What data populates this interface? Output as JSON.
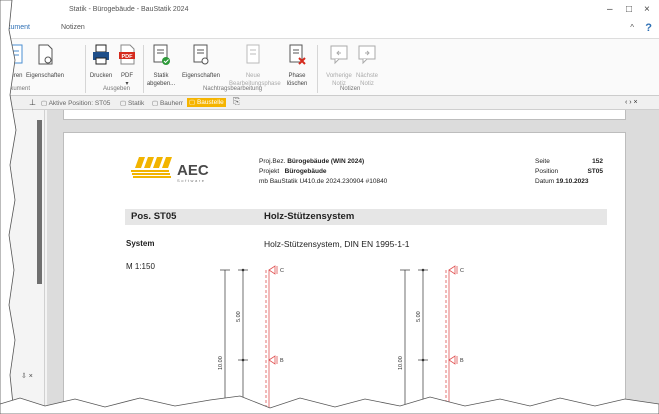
{
  "window": {
    "title": "Statik - Bürogebäude - BauStatik 2024",
    "minimize_glyph": "–",
    "maximize_glyph": "□",
    "close_glyph": "×"
  },
  "ribbon_tabs": [
    "kument",
    "Notizen"
  ],
  "help_glyph": "?",
  "caret_glyph": "^",
  "ribbon": {
    "buttons": [
      {
        "label": "tieren",
        "icon": "document-icon"
      },
      {
        "label": "Eigenschaften",
        "icon": "document-gear-icon"
      },
      {
        "label": "Drucken",
        "icon": "printer-icon"
      },
      {
        "label": "PDF",
        "sub": "▾",
        "icon": "pdf-icon"
      },
      {
        "label": "Statik",
        "sub": "abgeben...",
        "icon": "statik-submit-icon"
      },
      {
        "label": "Eigenschaften",
        "icon": "statik-properties-icon"
      },
      {
        "label": "Neue",
        "sub": "Bearbeitungsphase",
        "icon": "new-phase-icon",
        "disabled": true
      },
      {
        "label": "Phase",
        "sub": "löschen",
        "icon": "delete-phase-icon"
      },
      {
        "label": "Vorherige",
        "sub": "Notiz",
        "icon": "prev-note-icon",
        "disabled": true
      },
      {
        "label": "Nächste",
        "sub": "Notiz",
        "icon": "next-note-icon",
        "disabled": true
      }
    ],
    "groups": [
      "okument",
      "Ausgeben",
      "Nachtragsbearbeitung",
      "Notizen"
    ]
  },
  "doc_tabs": {
    "pin_glyph": "📌",
    "items": [
      "Aktive Position: ST05",
      "Statik",
      "Bauherr",
      "Baustelle"
    ],
    "active_index": 3,
    "nav_glyph": "‹ › ×"
  },
  "left_panel": {
    "bottom_glyph": "⇩ ×"
  },
  "page": {
    "logo_text": "AEC",
    "logo_sub": "Software",
    "header": {
      "proj_label": "Proj.Bez.",
      "proj_value": "Bürogebäude (WIN 2024)",
      "projekt_label": "Projekt",
      "projekt_value": "Bürogebäude",
      "program": "mb BauStatik U410.de  2024.230904 #10840",
      "seite_label": "Seite",
      "seite_value": "152",
      "position_label": "Position",
      "position_value": "ST05",
      "datum_label": "Datum",
      "datum_value": "19.10.2023"
    },
    "pos_label": "Pos. ST05",
    "pos_title": "Holz-Stützensystem",
    "system_label": "System",
    "system_text": "Holz-Stützensystem, DIN EN 1995-1-1",
    "scale": "M 1:150",
    "drawing": {
      "dim_total": "10.00",
      "dim_upper": "5.00",
      "dim_lower": "00",
      "support_top": "C",
      "support_mid": "B"
    }
  }
}
